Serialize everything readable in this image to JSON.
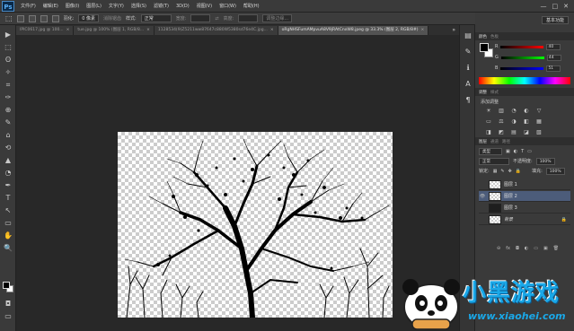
{
  "app": {
    "logo": "Ps",
    "menu": [
      "文件(F)",
      "编辑(E)",
      "图像(I)",
      "图层(L)",
      "文字(Y)",
      "选择(S)",
      "滤镜(T)",
      "3D(D)",
      "视图(V)",
      "窗口(W)",
      "帮助(H)"
    ],
    "window_controls": [
      "—",
      "□",
      "✕"
    ]
  },
  "options_bar": {
    "feather_label": "羽化:",
    "feather_value": "0 像素",
    "antialias_label": "消除锯齿",
    "style_label": "样式:",
    "style_value": "正常",
    "width_label": "宽度:",
    "height_label": "高度:",
    "refine_edge_button": "调整边缘...",
    "workspace": "基本功能"
  },
  "tabs": [
    {
      "label": "IPIC0617.jpg @ 100...",
      "active": false
    },
    {
      "label": "tue.jpg @ 100% (图层 1, RGB/8...",
      "active": false
    },
    {
      "label": "1128534(9)Z5211ww87647c880W5380sd76e4C.jpg...",
      "active": false
    },
    {
      "label": "oRgNHSFumAMpvuA8V9jRAtCnxW8.jpeg @ 33.3% (图层 2, RGB/8#)",
      "active": true
    }
  ],
  "color_panel": {
    "tabs": [
      "颜色",
      "色板"
    ],
    "channels": [
      {
        "label": "R",
        "value": "40",
        "track_color": "#c84040"
      },
      {
        "label": "G",
        "value": "44",
        "track_color": "#40a040"
      },
      {
        "label": "B",
        "value": "51",
        "track_color": "#4060c8"
      }
    ]
  },
  "adjustments_panel": {
    "tabs": [
      "调整",
      "样式"
    ],
    "add_label": "添加调整",
    "icons": [
      "☀",
      "▥",
      "◔",
      "◐",
      "▽",
      "▭",
      "⚖",
      "◑",
      "◧",
      "▦",
      "◨",
      "◩",
      "▤",
      "◪",
      "▧"
    ]
  },
  "layers_panel": {
    "tabs": [
      "图层",
      "通道",
      "路径"
    ],
    "filter_label": "类型",
    "blend_mode": "正常",
    "opacity_label": "不透明度:",
    "opacity_value": "100%",
    "lock_label": "锁定:",
    "fill_label": "填充:",
    "fill_value": "100%",
    "layers": [
      {
        "name": "图层 1",
        "thumb": "checker",
        "visible": false,
        "selected": false,
        "locked": false
      },
      {
        "name": "图层 2",
        "thumb": "checker",
        "visible": true,
        "selected": true,
        "locked": false
      },
      {
        "name": "图层 3",
        "thumb": "dark",
        "visible": false,
        "selected": false,
        "locked": false
      },
      {
        "name": "背景",
        "thumb": "checker",
        "visible": false,
        "selected": false,
        "locked": true
      }
    ],
    "footer_icons": [
      "⊖",
      "fx",
      "◘",
      "◐",
      "▭",
      "▣",
      "🗑"
    ]
  },
  "tools": [
    "▶",
    "⬚",
    "ʘ",
    "✧",
    "⌗",
    "✑",
    "⊕",
    "✎",
    "⌂",
    "⟲",
    "▲",
    "◔",
    "✒",
    "T",
    "↖",
    "▭",
    "✋",
    "🔍"
  ],
  "watermark": {
    "title": "小黑游戏",
    "url": "www.xiaohei.com"
  },
  "colors": {
    "accent": "#1aa8e8",
    "selection": "#4c5c7a"
  }
}
